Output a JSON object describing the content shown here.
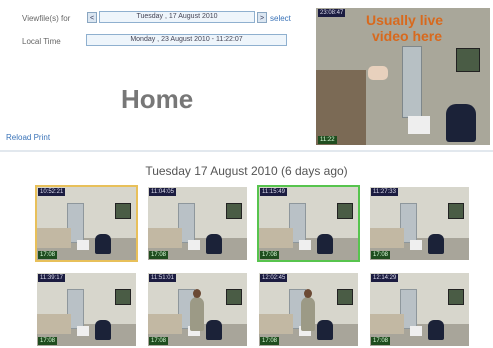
{
  "header": {
    "viewfile_label": "Viewfile(s) for",
    "prev_label": "<",
    "date_value": "Tuesday , 17 August 2010",
    "next_label": ">",
    "select_label": "select",
    "localtime_label": "Local Time",
    "localtime_value": "Monday , 23 August 2010 - 11:22:07"
  },
  "page": {
    "title": "Home",
    "reload_label": "Reload",
    "print_label": "Print"
  },
  "live_view": {
    "overlay_line1": "Usually live",
    "overlay_line2": "video here",
    "timestamp_top": "23:08:47",
    "timestamp_bottom": "11:22"
  },
  "day": {
    "heading": "Tuesday 17 August 2010 (6 days ago)"
  },
  "thumbnails": [
    {
      "top_stamp": "10:52:21",
      "bottom_stamp": "17:08",
      "highlight": "yellow",
      "person": false
    },
    {
      "top_stamp": "11:04:05",
      "bottom_stamp": "17:08",
      "highlight": "none",
      "person": false
    },
    {
      "top_stamp": "11:15:49",
      "bottom_stamp": "17:08",
      "highlight": "green",
      "person": false
    },
    {
      "top_stamp": "11:27:33",
      "bottom_stamp": "17:08",
      "highlight": "none",
      "person": false
    },
    {
      "top_stamp": "11:39:17",
      "bottom_stamp": "17:08",
      "highlight": "none",
      "person": false
    },
    {
      "top_stamp": "11:51:01",
      "bottom_stamp": "17:08",
      "highlight": "none",
      "person": true
    },
    {
      "top_stamp": "12:02:45",
      "bottom_stamp": "17:08",
      "highlight": "none",
      "person": true
    },
    {
      "top_stamp": "12:14:29",
      "bottom_stamp": "17:08",
      "highlight": "none",
      "person": false
    }
  ],
  "colors": {
    "link": "#3a73b8",
    "overlay_text": "#d8691d",
    "highlight_yellow": "#e8c05a",
    "highlight_green": "#57c44e"
  }
}
